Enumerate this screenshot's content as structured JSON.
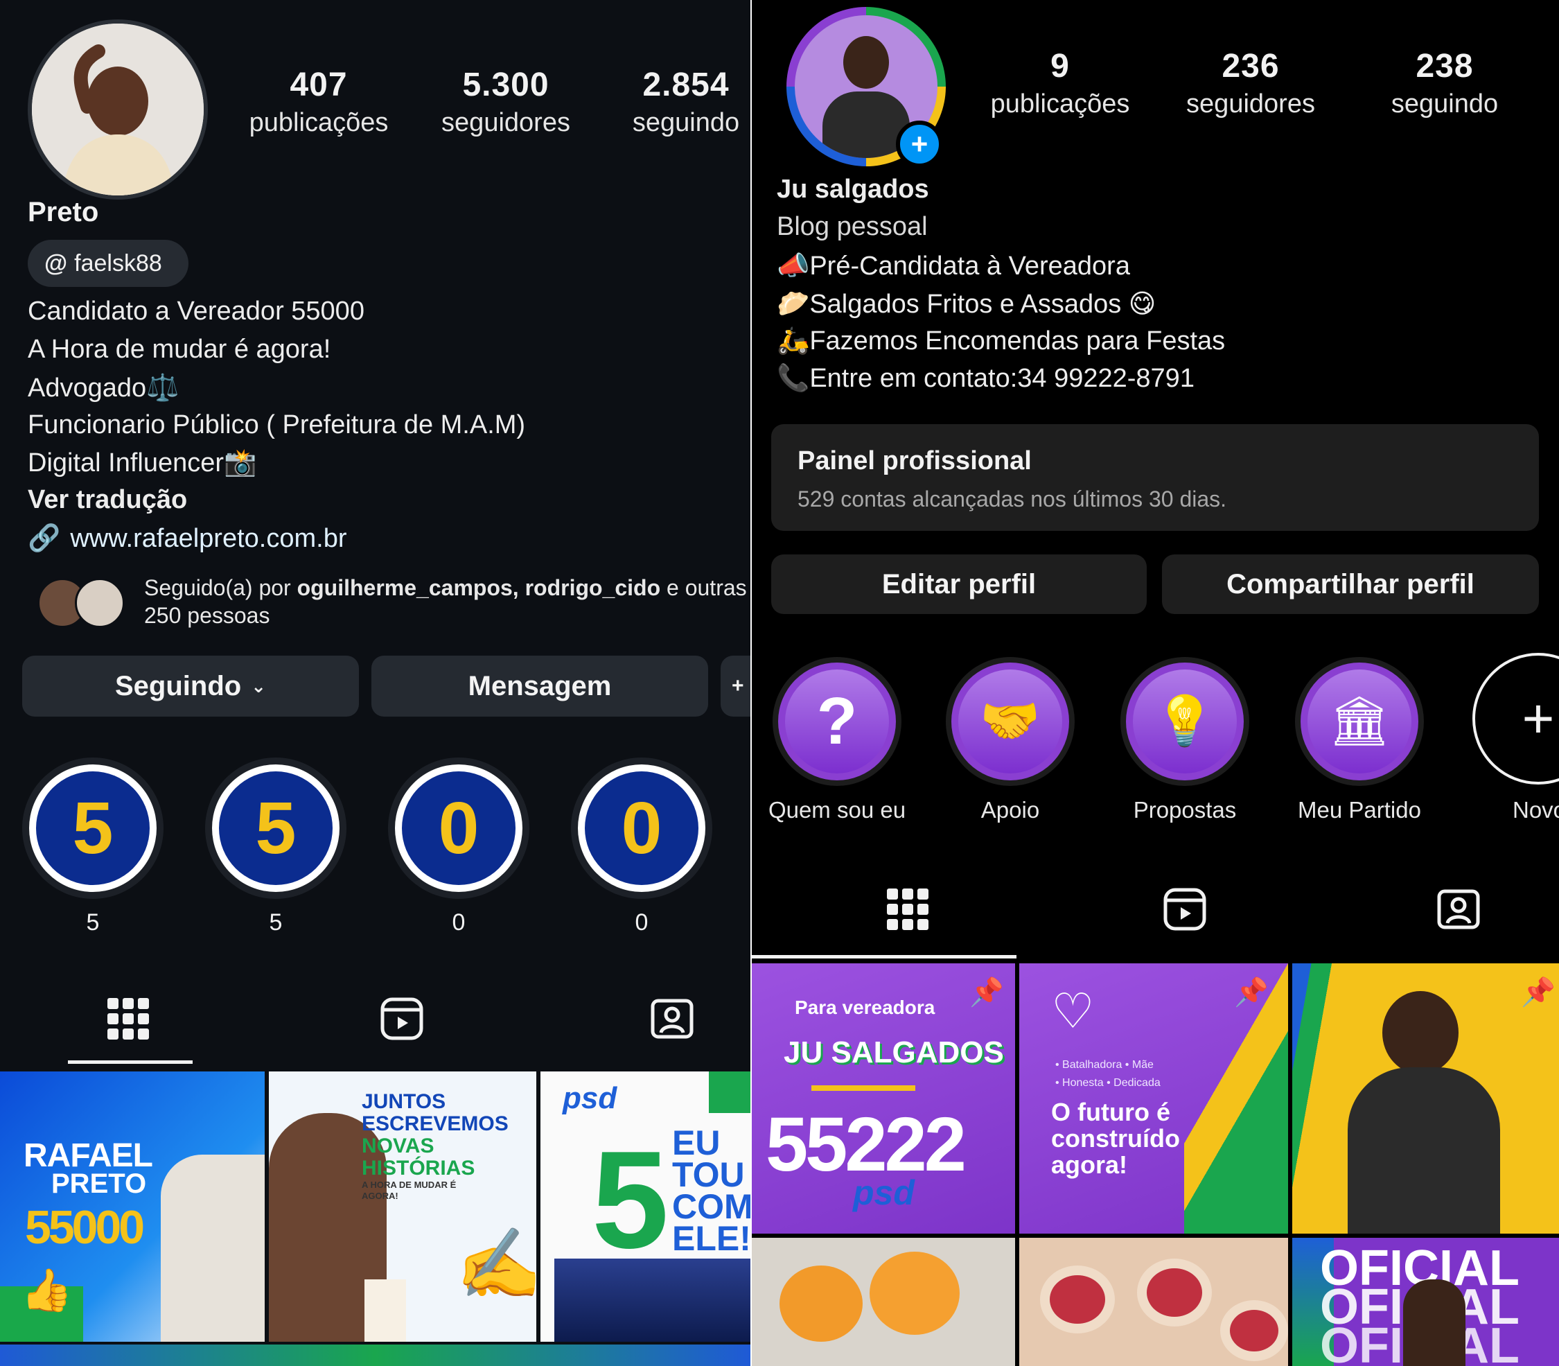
{
  "left": {
    "stats": [
      {
        "num": "407",
        "label": "publicações"
      },
      {
        "num": "5.300",
        "label": "seguidores"
      },
      {
        "num": "2.854",
        "label": "seguindo"
      }
    ],
    "name": "Preto",
    "threads_handle": "faelsk88",
    "bio": [
      "Candidato a Vereador 55000",
      "A Hora de mudar é agora!",
      "Advogado⚖️",
      "Funcionario Público ( Prefeitura de M.A.M)",
      "Digital Influencer📸"
    ],
    "translate": "Ver tradução",
    "link": "www.rafaelpreto.com.br",
    "followed_by_prefix": "Seguido(a) por ",
    "followed_by_names": "oguilherme_campos, rodrigo_cido",
    "followed_by_suffix": " e outras",
    "followed_by_line2": "250 pessoas",
    "btn_following": "Seguindo",
    "btn_message": "Mensagem",
    "highlights": [
      {
        "digit": "5",
        "label": "5"
      },
      {
        "digit": "5",
        "label": "5"
      },
      {
        "digit": "0",
        "label": "0"
      },
      {
        "digit": "0",
        "label": "0"
      }
    ],
    "posts": [
      {
        "l1": "RAFAEL",
        "l2": "PRETO",
        "l3": "55000"
      },
      {
        "l1": "JUNTOS",
        "l2": "ESCREVEMOS",
        "l3": "NOVAS",
        "l4": "HISTÓRIAS",
        "l5": "A HORA DE MUDAR É AGORA!"
      },
      {
        "l1": "psd",
        "l2": "5",
        "l3": "EU",
        "l4": "TOU",
        "l5": "COM",
        "l6": "ELE!"
      }
    ]
  },
  "right": {
    "stats": [
      {
        "num": "9",
        "label": "publicações"
      },
      {
        "num": "236",
        "label": "seguidores"
      },
      {
        "num": "238",
        "label": "seguindo"
      }
    ],
    "name": "Ju salgados",
    "category": "Blog pessoal",
    "bio": [
      {
        "emoji": "📣",
        "text": "Pré-Candidata à Vereadora"
      },
      {
        "emoji": "🥟",
        "text": "Salgados Fritos e Assados 😋"
      },
      {
        "emoji": "🛵",
        "text": "Fazemos Encomendas para Festas"
      },
      {
        "emoji": "📞",
        "text": "Entre em contato:34 99222-8791"
      }
    ],
    "dashboard_title": "Painel profissional",
    "dashboard_sub": "529 contas alcançadas nos últimos 30 dias.",
    "btn_edit": "Editar perfil",
    "btn_share": "Compartilhar perfil",
    "highlights": [
      {
        "label": "Quem sou eu"
      },
      {
        "label": "Apoio"
      },
      {
        "label": "Propostas"
      },
      {
        "label": "Meu Partido"
      },
      {
        "label": "Novo"
      }
    ],
    "posts": [
      {
        "l1": "Para vereadora",
        "l2": "JU SALGADOS",
        "l3": "55222",
        "l4": "psd"
      },
      {
        "l1": "• Batalhadora • Mãe",
        "l2": "• Honesta • Dedicada",
        "l3": "O futuro é",
        "l4": "construído",
        "l5": "agora!"
      },
      {},
      {},
      {},
      {
        "l1": "OFICIAL"
      }
    ]
  },
  "colors": {
    "accent_blue": "#0095f6",
    "purple": "#8a3fd1",
    "yellow": "#f4c21a",
    "navy": "#0b2c8f"
  }
}
